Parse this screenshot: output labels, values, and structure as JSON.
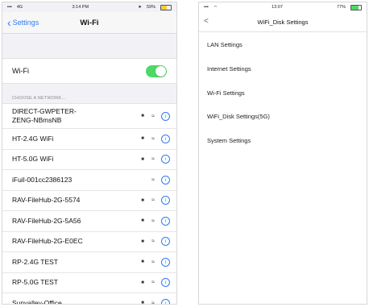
{
  "left": {
    "status": {
      "carrier": "4G",
      "time": "3:14 PM",
      "battery": "59%"
    },
    "nav": {
      "back": "Settings",
      "title": "Wi-Fi"
    },
    "wifi_label": "Wi-Fi",
    "wifi_enabled": true,
    "section_header": "CHOOSE A NETWORK...",
    "networks": [
      {
        "name_line1": "DIRECT-GWPETER-",
        "name_line2": "ZENG-NBmsNB",
        "locked": true
      },
      {
        "name_line1": "HT-2.4G WiFi",
        "name_line2": "",
        "locked": true
      },
      {
        "name_line1": "HT-5.0G WiFi",
        "name_line2": "",
        "locked": true
      },
      {
        "name_line1": "iFuil-001cc2386123",
        "name_line2": "",
        "locked": false
      },
      {
        "name_line1": "RAV-FileHub-2G-5574",
        "name_line2": "",
        "locked": true
      },
      {
        "name_line1": "RAV-FileHub-2G-5A56",
        "name_line2": "",
        "locked": true
      },
      {
        "name_line1": "RAV-FileHub-2G-E0EC",
        "name_line2": "",
        "locked": true
      },
      {
        "name_line1": "RP-2.4G TEST",
        "name_line2": "",
        "locked": true
      },
      {
        "name_line1": "RP-5.0G TEST",
        "name_line2": "",
        "locked": true
      },
      {
        "name_line1": "Sunvalley-Office",
        "name_line2": "",
        "locked": true
      }
    ]
  },
  "right": {
    "status": {
      "time": "13:07",
      "battery": "77%"
    },
    "nav": {
      "back": "<",
      "title": "WiFi_Disk Settings"
    },
    "items": [
      "LAN Settings",
      "Internet Settings",
      "Wi-Fi Settings",
      "WiFi_Disk Settings(5G)",
      "System Settings"
    ]
  },
  "colors": {
    "accent": "#2e7cf6",
    "toggle_on": "#4cd964"
  }
}
